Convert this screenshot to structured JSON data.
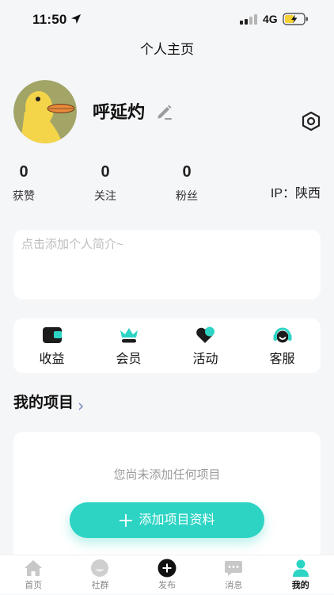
{
  "status_bar": {
    "time": "11:50",
    "network": "4G"
  },
  "header": {
    "title": "个人主页"
  },
  "profile": {
    "name": "呼延灼",
    "ip_location": "IP：陕西"
  },
  "stats": [
    {
      "value": "0",
      "label": "获赞"
    },
    {
      "value": "0",
      "label": "关注"
    },
    {
      "value": "0",
      "label": "粉丝"
    }
  ],
  "bio": {
    "placeholder": "点击添加个人简介~"
  },
  "quick_menu": [
    {
      "label": "收益",
      "icon": "wallet-icon"
    },
    {
      "label": "会员",
      "icon": "crown-icon"
    },
    {
      "label": "活动",
      "icon": "heart-icon"
    },
    {
      "label": "客服",
      "icon": "headset-icon"
    }
  ],
  "projects": {
    "title": "我的项目",
    "empty_text": "您尚未添加任何项目",
    "add_button_label": "添加项目资料"
  },
  "tab_bar": {
    "items": [
      {
        "label": "首页",
        "icon": "home-icon",
        "active": false
      },
      {
        "label": "社群",
        "icon": "community-icon",
        "active": false
      },
      {
        "label": "发布",
        "icon": "publish-icon",
        "active": false
      },
      {
        "label": "消息",
        "icon": "message-icon",
        "active": false
      },
      {
        "label": "我的",
        "icon": "profile-icon",
        "active": true
      }
    ]
  },
  "colors": {
    "accent": "#2DD4C4",
    "page_background": "#F5F6F8",
    "card_background": "#FFFFFF",
    "placeholder_text": "#BDBDBD"
  }
}
